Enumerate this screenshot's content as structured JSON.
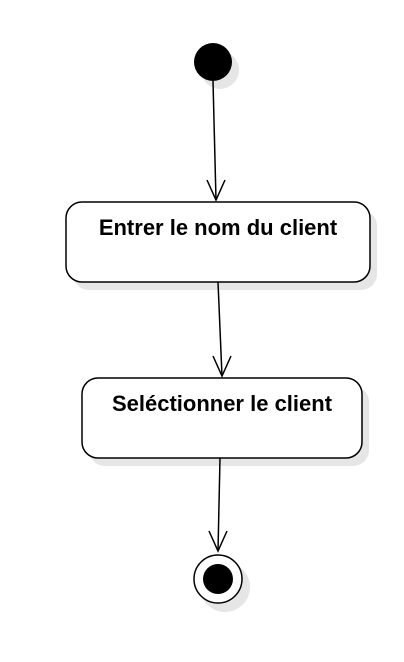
{
  "diagram": {
    "type": "uml-activity",
    "nodes": [
      {
        "id": "start",
        "kind": "initial"
      },
      {
        "id": "action-1",
        "kind": "action",
        "label": "Entrer le nom du client"
      },
      {
        "id": "action-2",
        "kind": "action",
        "label": "Seléctionner le client"
      },
      {
        "id": "end",
        "kind": "final"
      }
    ],
    "edges": [
      {
        "from": "start",
        "to": "action-1"
      },
      {
        "from": "action-1",
        "to": "action-2"
      },
      {
        "from": "action-2",
        "to": "end"
      }
    ]
  },
  "colors": {
    "stroke": "#000000",
    "fill": "#ffffff",
    "shadow": "#e6e6e6",
    "node_fill": "#000000"
  }
}
